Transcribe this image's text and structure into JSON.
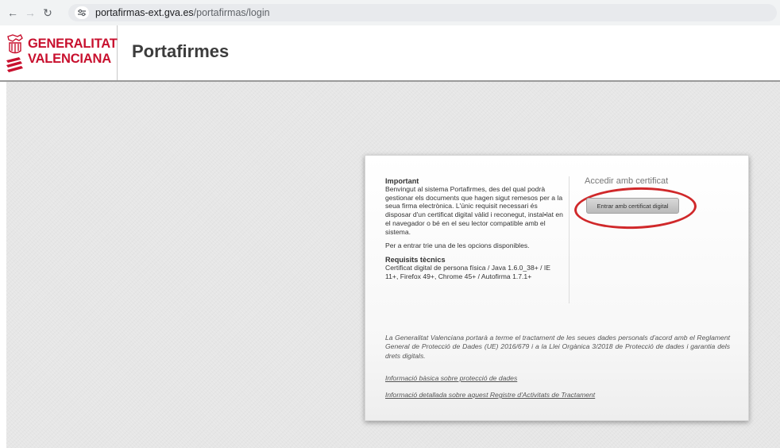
{
  "browser": {
    "url_host": "portafirmas-ext.gva.es",
    "url_path": "/portafirmas/login",
    "nav": [
      "back",
      "forward",
      "reload"
    ]
  },
  "header": {
    "logo_line1": "GENERALITAT",
    "logo_line2": "VALENCIANA",
    "app_title": "Portafirmes"
  },
  "colors": {
    "brand_red": "#c8102e",
    "highlight_red": "#d0282a",
    "background": "#e6e6e6"
  },
  "login": {
    "info_heading": "Important",
    "info_paragraph": "Benvingut al sistema Portafirmes, des del qual podrà gestionar els documents que hagen sigut remesos per a la seua firma electrònica. L'únic requisit necessari és disposar d'un certificat digital vàlid i reconegut, instal•lat en el navegador o bé en el seu lector compatible amb el sistema.",
    "info_choose": "Per a entrar trie una de les opcions disponibles.",
    "requirements_heading": "Requisits tècnics",
    "requirements_text": "Certificat digital de persona física / Java 1.6.0_38+ / IE 11+, Firefox 49+, Chrome 45+ / Autofirma 1.7.1+",
    "cert_title": "Accedir amb certificat",
    "cert_button": "Entrar amb certificat digital",
    "legal_text": "La Generalitat Valenciana portarà a terme el tractament de les seues dades personals d'acord amb el Reglament General de Protecció de Dades (UE) 2016/679 i a la Llei Orgànica 3/2018 de Protecció de dades i garantia dels drets digitals.",
    "link_basic": "Informació bàsica sobre protecció de dades",
    "link_detailed": "Informació detallada sobre aquest Registre d'Activitats de Tractament"
  }
}
